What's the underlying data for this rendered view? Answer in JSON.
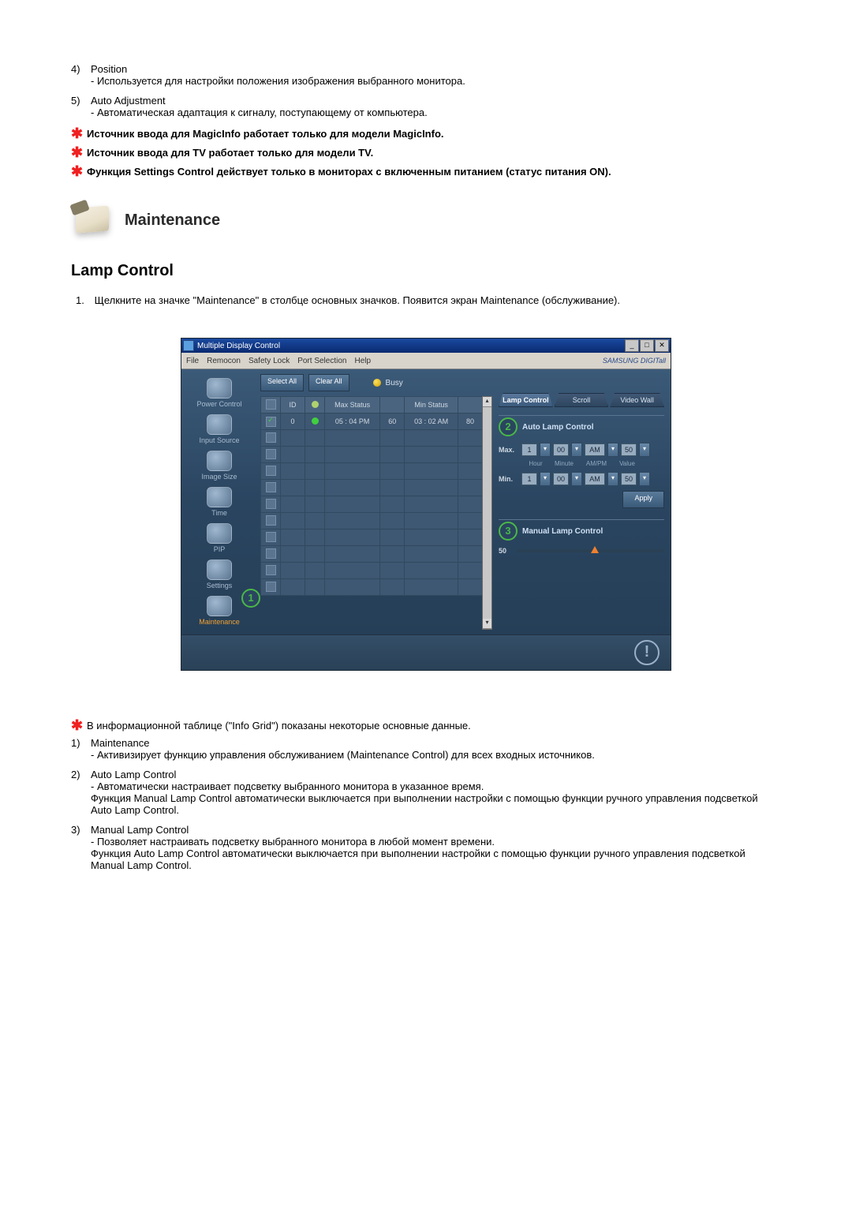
{
  "top_items": [
    {
      "num": "4)",
      "title": "Position",
      "desc": "- Используется для настройки положения изображения выбранного монитора."
    },
    {
      "num": "5)",
      "title": "Auto Adjustment",
      "desc": "- Автоматическая адаптация к сигналу, поступающему от компьютера."
    }
  ],
  "top_stars": [
    "Источник ввода для MagicInfo работает только для модели MagicInfo.",
    "Источник ввода для TV работает только для модели TV.",
    "Функция Settings Control действует только в мониторах с включенным питанием (статус питания ON)."
  ],
  "section_title": "Maintenance",
  "h2": "Lamp Control",
  "step1_num": "1.",
  "step1_text": "Щелкните на значке \"Maintenance\" в столбце основных значков. Появится экран Maintenance (обслуживание).",
  "window": {
    "title": "Multiple Display Control",
    "menus": [
      "File",
      "Remocon",
      "Safety Lock",
      "Port Selection",
      "Help"
    ],
    "brand": "SAMSUNG DIGITall",
    "buttons": {
      "select_all": "Select All",
      "clear_all": "Clear All",
      "busy": "Busy",
      "apply": "Apply"
    },
    "sidebar": [
      {
        "label": "Power Control"
      },
      {
        "label": "Input Source"
      },
      {
        "label": "Image Size"
      },
      {
        "label": "Time"
      },
      {
        "label": "PIP"
      },
      {
        "label": "Settings"
      },
      {
        "label": "Maintenance"
      }
    ],
    "grid": {
      "headers": {
        "chk": "☑",
        "id": "ID",
        "dot": "◉",
        "max": "Max Status",
        "maxv": "",
        "min": "Min Status",
        "minv": ""
      },
      "row0": {
        "id": "0",
        "max": "05 : 04 PM",
        "maxv": "60",
        "min": "03 : 02 AM",
        "minv": "80"
      }
    },
    "tabs": [
      "Lamp Control",
      "Scroll",
      "Video Wall"
    ],
    "panel": {
      "auto_title": "Auto Lamp Control",
      "manual_title": "Manual Lamp Control",
      "max_label": "Max.",
      "min_label": "Min.",
      "labels": {
        "hour": "Hour",
        "minute": "Minute",
        "ampm": "AM/PM",
        "value": "Value"
      },
      "max": {
        "hour": "1",
        "minute": "00",
        "ampm": "AM",
        "value": "50"
      },
      "min": {
        "hour": "1",
        "minute": "00",
        "ampm": "AM",
        "value": "50"
      },
      "manual_value": "50"
    },
    "callouts": {
      "c1": "1",
      "c2": "2",
      "c3": "3"
    }
  },
  "bottom_star": "В информационной таблице (\"Info Grid\") показаны некоторые основные данные.",
  "bottom_items": [
    {
      "num": "1)",
      "title": "Maintenance",
      "desc": "- Активизирует функцию управления обслуживанием (Maintenance Control) для всех входных источников."
    },
    {
      "num": "2)",
      "title": "Auto Lamp Control",
      "desc": "- Автоматически настраивает подсветку выбранного монитора в указанное время.\nФункция Manual Lamp Control автоматически выключается при выполнении настройки с помощью функции ручного управления подсветкой Auto Lamp Control."
    },
    {
      "num": "3)",
      "title": "Manual Lamp Control",
      "desc": "- Позволяет настраивать подсветку выбранного монитора в любой момент времени.\nФункция Auto Lamp Control автоматически выключается при выполнении настройки с помощью функции ручного управления подсветкой Manual Lamp Control."
    }
  ]
}
